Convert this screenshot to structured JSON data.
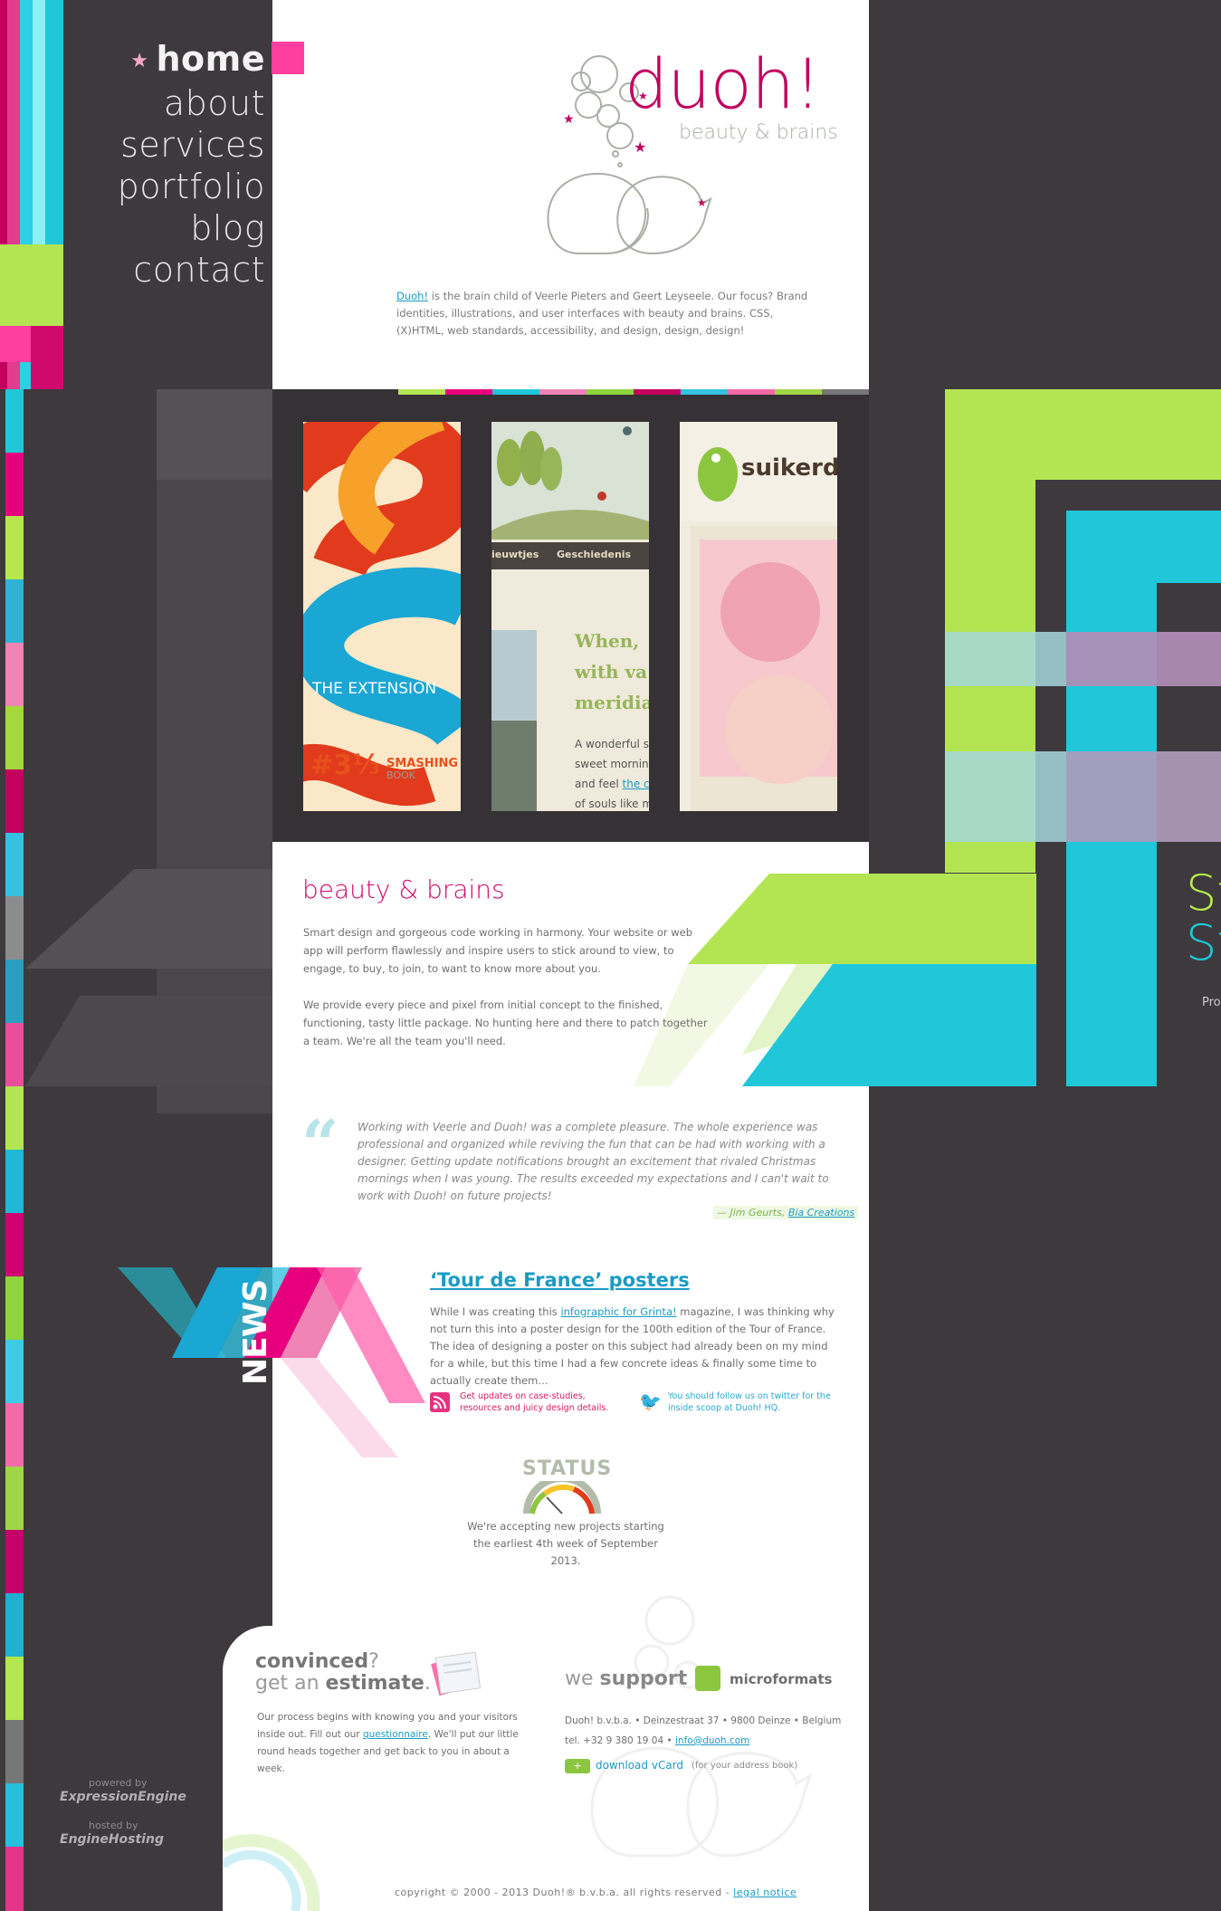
{
  "colors": {
    "brand": "#c2005f",
    "link": "#1a9bc4",
    "lime": "#b3e553",
    "cyan": "#1fc7d9",
    "dark": "#3d393d"
  },
  "nav": {
    "items": [
      {
        "label": "home",
        "active": true
      },
      {
        "label": "about"
      },
      {
        "label": "services"
      },
      {
        "label": "portfolio"
      },
      {
        "label": "blog"
      },
      {
        "label": "contact"
      }
    ]
  },
  "logo": {
    "word": "duoh!",
    "tagline": "beauty & brains"
  },
  "intro": {
    "link": "Duoh!",
    "text": " is the brain child of Veerle Pieters and Geert Leyseele. Our focus? Brand identities, illustrations, and user interfaces with beauty and brains. CSS, (X)HTML, web standards, accessibility, and design, design, design!"
  },
  "portfolio": {
    "thumbs": [
      {
        "title": "THE EXTENSION",
        "sub": "#3⅓",
        "brand": "SMASHING",
        "brand2": "BOOK"
      },
      {
        "nav1": "ieuwtjes",
        "nav2": "Geschiedenis",
        "headline1": "When,",
        "headline2": "with va",
        "headline3": "meridia",
        "body1": "A wonderful s",
        "body2": "sweet morning",
        "body3": "and feel",
        "body3link": "the c",
        "body4": "of souls like m"
      },
      {
        "brand": "suikerd"
      }
    ]
  },
  "beauty": {
    "heading": "beauty & brains",
    "p1": "Smart design and gorgeous code working in harmony. Your website or web app will perform flawlessly and inspire users to stick around to view, to engage, to buy, to join, to want to know more about you.",
    "p2": "We provide every piece and pixel from initial concept to the finished, functioning, tasty little package. No hunting here and there to patch together a team. We're all the team you'll need."
  },
  "testimonial": {
    "mark": "“",
    "text": "Working with Veerle and Duoh! was a complete pleasure. The whole experience was professional and organized while reviving the fun that can be had with working with a designer. Getting update notifications brought an excitement that rivaled Christmas mornings when I was young. The results exceeded my expectations and I can't wait to work with Duoh! on future projects!",
    "author": "— Jim Geurts, ",
    "company": "Bia Creations"
  },
  "news": {
    "label": "NEWS",
    "title": "‘Tour de France’ posters",
    "body_pre": "While I was creating this ",
    "body_link": "infographic for Grinta!",
    "body_post": " magazine, I was thinking why not turn this into a poster design for the 100th edition of the Tour of France. The idea of designing a poster on this subject had already been on my mind for a while, but this time I had a few concrete ideas & finally some time to actually create them…",
    "rss": "Get updates on case-studies, resources and juicy design details.",
    "twitter": "You should follow us on twitter for the inside scoop at Duoh! HQ."
  },
  "status": {
    "label": "STATUS",
    "text": "We're accepting new projects starting the earliest 4th week of September 2013."
  },
  "estimate": {
    "line1a": "convinced",
    "line1b": "?",
    "line2a": "get an ",
    "line2b": "estimate",
    "line2c": ".",
    "text_pre": "Our process begins with knowing you and your visitors inside out. Fill out our ",
    "link": "questionnaire",
    "text_post": ". We'll put our little round heads together and get back to you in about a week."
  },
  "support": {
    "we": "we ",
    "support": "support",
    "microformats": "microformats",
    "address": "Duoh! b.v.b.a.  •  Deinzestraat 37  •  9800 Deinze  •  Belgium",
    "tel": "tel. +32 9 380 19 04  •  ",
    "email": "info@duoh.com",
    "vcard": "download vCard",
    "vcard_note": "(for your address book)"
  },
  "credits": {
    "powered": "powered by",
    "ee": "ExpressionEngine",
    "hosted": "hosted by",
    "eh": "EngineHosting"
  },
  "footer": {
    "copyright": "copyright © 2000 - 2013 Duoh!® b.v.b.a. all rights reserved - ",
    "legal": "legal notice"
  },
  "right_deco": {
    "t1": "St",
    "t2": "St",
    "t3": "Pro"
  }
}
